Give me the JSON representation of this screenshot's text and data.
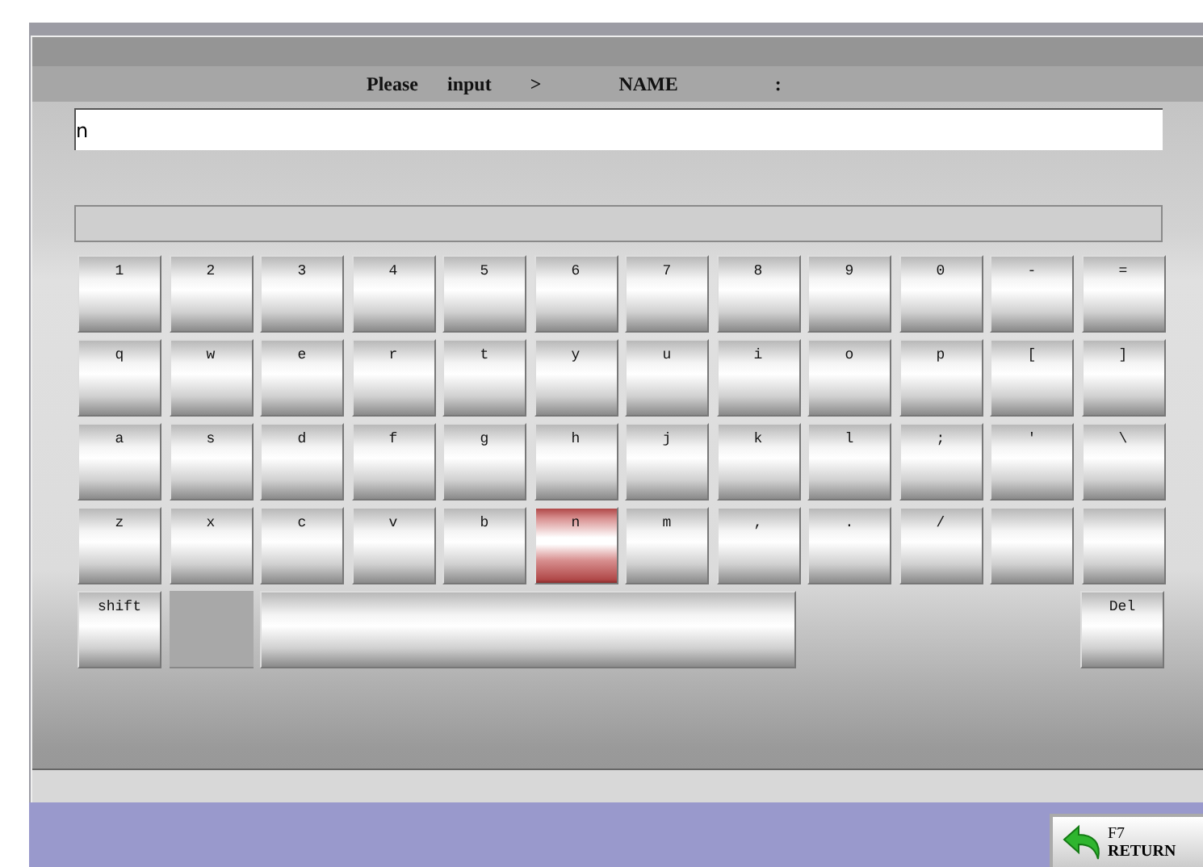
{
  "prompt": {
    "parts": [
      "Please",
      "input",
      ">",
      "NAME",
      ":"
    ]
  },
  "input": {
    "value": "n"
  },
  "keyboard": {
    "rows": [
      [
        {
          "kind": "key",
          "label": "1",
          "selected": false
        },
        {
          "kind": "key",
          "label": "2",
          "selected": false
        },
        {
          "kind": "key",
          "label": "3",
          "selected": false
        },
        {
          "kind": "key",
          "label": "4",
          "selected": false
        },
        {
          "kind": "key",
          "label": "5",
          "selected": false
        },
        {
          "kind": "key",
          "label": "6",
          "selected": false
        },
        {
          "kind": "key",
          "label": "7",
          "selected": false
        },
        {
          "kind": "key",
          "label": "8",
          "selected": false
        },
        {
          "kind": "key",
          "label": "9",
          "selected": false
        },
        {
          "kind": "key",
          "label": "0",
          "selected": false
        },
        {
          "kind": "key",
          "label": "-",
          "selected": false
        },
        {
          "kind": "key",
          "label": "=",
          "selected": false
        }
      ],
      [
        {
          "kind": "key",
          "label": "q",
          "selected": false
        },
        {
          "kind": "key",
          "label": "w",
          "selected": false
        },
        {
          "kind": "key",
          "label": "e",
          "selected": false
        },
        {
          "kind": "key",
          "label": "r",
          "selected": false
        },
        {
          "kind": "key",
          "label": "t",
          "selected": false
        },
        {
          "kind": "key",
          "label": "y",
          "selected": false
        },
        {
          "kind": "key",
          "label": "u",
          "selected": false
        },
        {
          "kind": "key",
          "label": "i",
          "selected": false
        },
        {
          "kind": "key",
          "label": "o",
          "selected": false
        },
        {
          "kind": "key",
          "label": "p",
          "selected": false
        },
        {
          "kind": "key",
          "label": "[",
          "selected": false
        },
        {
          "kind": "key",
          "label": "]",
          "selected": false
        }
      ],
      [
        {
          "kind": "key",
          "label": "a",
          "selected": false
        },
        {
          "kind": "key",
          "label": "s",
          "selected": false
        },
        {
          "kind": "key",
          "label": "d",
          "selected": false
        },
        {
          "kind": "key",
          "label": "f",
          "selected": false
        },
        {
          "kind": "key",
          "label": "g",
          "selected": false
        },
        {
          "kind": "key",
          "label": "h",
          "selected": false
        },
        {
          "kind": "key",
          "label": "j",
          "selected": false
        },
        {
          "kind": "key",
          "label": "k",
          "selected": false
        },
        {
          "kind": "key",
          "label": "l",
          "selected": false
        },
        {
          "kind": "key",
          "label": ";",
          "selected": false
        },
        {
          "kind": "key",
          "label": "'",
          "selected": false
        },
        {
          "kind": "key",
          "label": "\\",
          "selected": false
        }
      ],
      [
        {
          "kind": "key",
          "label": "z",
          "selected": false
        },
        {
          "kind": "key",
          "label": "x",
          "selected": false
        },
        {
          "kind": "key",
          "label": "c",
          "selected": false
        },
        {
          "kind": "key",
          "label": "v",
          "selected": false
        },
        {
          "kind": "key",
          "label": "b",
          "selected": false
        },
        {
          "kind": "key",
          "label": "n",
          "selected": true
        },
        {
          "kind": "key",
          "label": "m",
          "selected": false
        },
        {
          "kind": "key",
          "label": ",",
          "selected": false
        },
        {
          "kind": "key",
          "label": ".",
          "selected": false
        },
        {
          "kind": "key",
          "label": "/",
          "selected": false
        },
        {
          "kind": "blank",
          "selected": false
        },
        {
          "kind": "blank",
          "selected": false
        }
      ]
    ],
    "bottom_keys": {
      "shift": {
        "label": "shift",
        "selected": false
      },
      "space": {
        "selected": false
      },
      "delete": {
        "label": "Del",
        "selected": false
      }
    }
  },
  "return_button": {
    "key": "F7",
    "label": "RETURN"
  }
}
